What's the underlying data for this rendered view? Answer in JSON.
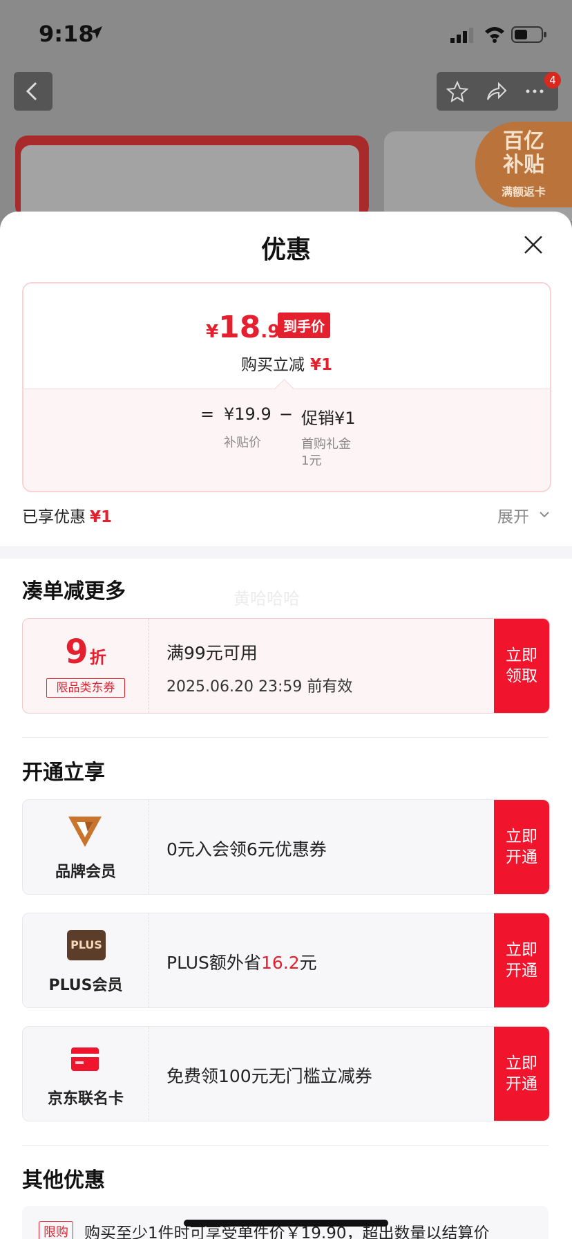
{
  "status_bar": {
    "time": "9:18"
  },
  "nav": {
    "badge_count": "4"
  },
  "banner": {
    "subsidy_line1": "百亿",
    "subsidy_line2": "补贴",
    "subsidy_line3": "满额返卡"
  },
  "sheet": {
    "title": "优惠",
    "price_card": {
      "yen": "¥",
      "final_int": "18",
      "final_dec": ".9",
      "final_tag": "到手价",
      "reduce_label": "购买立减",
      "reduce_value": "¥1",
      "formula": {
        "equals": "=",
        "base": "¥19.9",
        "base_label": "补贴价",
        "minus": "−",
        "promo": "促销¥1",
        "promo_label_1": "首购礼金",
        "promo_label_2": "1元"
      }
    },
    "enjoyed_label": "已享优惠",
    "enjoyed_value": "¥1",
    "expand_label": "展开"
  },
  "combine_section": {
    "title": "凑单减更多",
    "watermark": "黄哈哈哈",
    "coupon": {
      "discount_num": "9",
      "discount_unit": "折",
      "tag": "限品类东券",
      "condition": "满99元可用",
      "validity": "2025.06.20 23:59 前有效",
      "button_line1": "立即",
      "button_line2": "领取"
    }
  },
  "member_section": {
    "title": "开通立享",
    "items": [
      {
        "name": "品牌会员",
        "text": "0元入会领6元优惠券",
        "button_line1": "立即",
        "button_line2": "开通"
      },
      {
        "name": "PLUS会员",
        "logo_text": "PLUS",
        "text_prefix": "PLUS额外省",
        "text_amount": "16.2",
        "text_suffix": "元",
        "button_line1": "立即",
        "button_line2": "开通"
      },
      {
        "name": "京东联名卡",
        "text": "免费领100元无门槛立减券",
        "button_line1": "立即",
        "button_line2": "开通"
      }
    ]
  },
  "other_section": {
    "title": "其他优惠",
    "limit_tag": "限购",
    "limit_text": "购买至少1件时可享受单件价￥19.90，超出数量以结算价"
  },
  "colors": {
    "accent": "#e4202e",
    "button_red": "#f0142c",
    "card_pink": "#fdf4f5"
  }
}
